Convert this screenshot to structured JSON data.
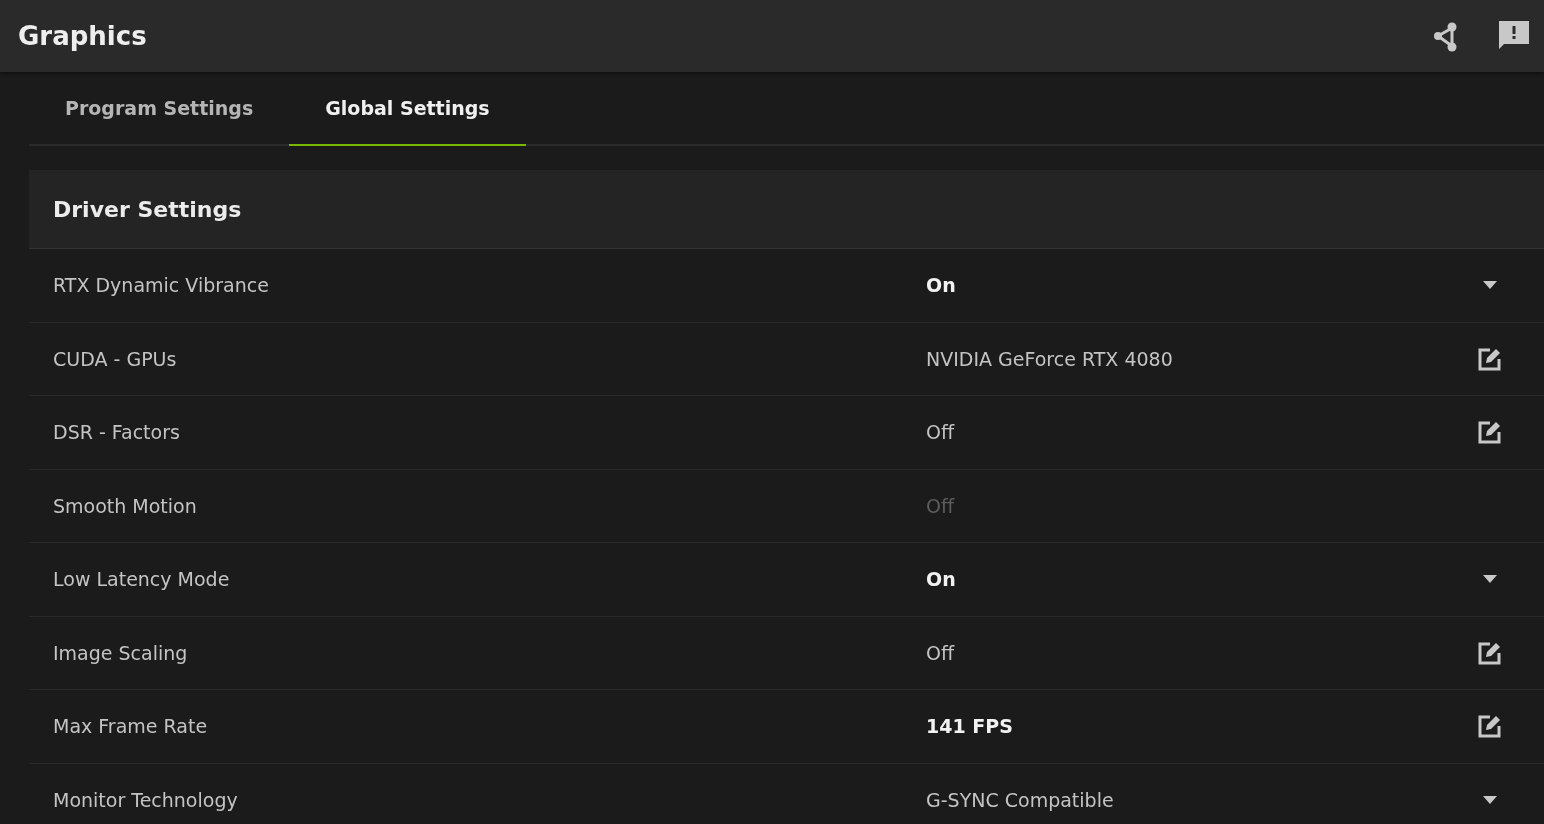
{
  "header": {
    "title": "Graphics"
  },
  "tabs": [
    {
      "label": "Program Settings",
      "selected": false
    },
    {
      "label": "Global Settings",
      "selected": true
    }
  ],
  "section": {
    "title": "Driver Settings"
  },
  "settings": [
    {
      "name": "RTX Dynamic Vibrance",
      "value": "On",
      "kind": "dropdown",
      "emphasized": true,
      "disabled": false
    },
    {
      "name": "CUDA - GPUs",
      "value": "NVIDIA GeForce RTX 4080",
      "kind": "edit",
      "emphasized": false,
      "disabled": false
    },
    {
      "name": "DSR - Factors",
      "value": "Off",
      "kind": "edit",
      "emphasized": false,
      "disabled": false
    },
    {
      "name": "Smooth Motion",
      "value": "Off",
      "kind": "none",
      "emphasized": false,
      "disabled": true
    },
    {
      "name": "Low Latency Mode",
      "value": "On",
      "kind": "dropdown",
      "emphasized": true,
      "disabled": false
    },
    {
      "name": "Image Scaling",
      "value": "Off",
      "kind": "edit",
      "emphasized": false,
      "disabled": false
    },
    {
      "name": "Max Frame Rate",
      "value": "141 FPS",
      "kind": "edit",
      "emphasized": true,
      "disabled": false
    },
    {
      "name": "Monitor Technology",
      "value": "G-SYNC Compatible",
      "kind": "dropdown",
      "emphasized": false,
      "disabled": false
    }
  ]
}
